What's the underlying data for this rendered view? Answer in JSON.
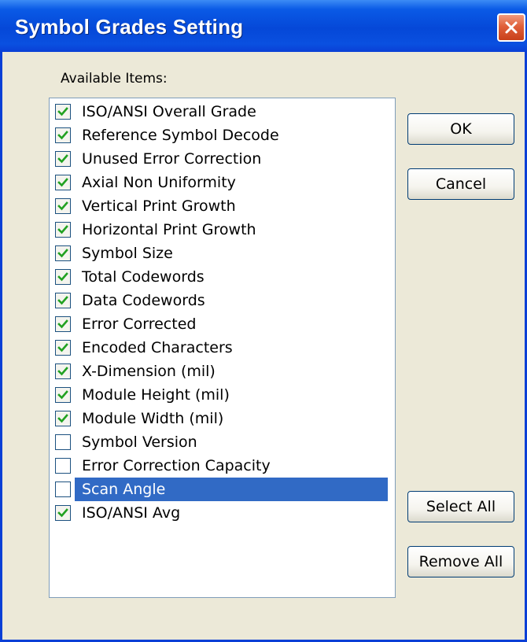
{
  "window": {
    "title": "Symbol Grades Setting"
  },
  "list": {
    "label": "Available Items:",
    "items": [
      {
        "label": "ISO/ANSI Overall Grade",
        "checked": true,
        "selected": false
      },
      {
        "label": "Reference Symbol Decode",
        "checked": true,
        "selected": false
      },
      {
        "label": "Unused Error Correction",
        "checked": true,
        "selected": false
      },
      {
        "label": "Axial Non Uniformity",
        "checked": true,
        "selected": false
      },
      {
        "label": "Vertical Print Growth",
        "checked": true,
        "selected": false
      },
      {
        "label": "Horizontal Print Growth",
        "checked": true,
        "selected": false
      },
      {
        "label": "Symbol Size",
        "checked": true,
        "selected": false
      },
      {
        "label": "Total Codewords",
        "checked": true,
        "selected": false
      },
      {
        "label": "Data Codewords",
        "checked": true,
        "selected": false
      },
      {
        "label": "Error Corrected",
        "checked": true,
        "selected": false
      },
      {
        "label": "Encoded Characters",
        "checked": true,
        "selected": false
      },
      {
        "label": "X-Dimension (mil)",
        "checked": true,
        "selected": false
      },
      {
        "label": "Module Height (mil)",
        "checked": true,
        "selected": false
      },
      {
        "label": "Module Width (mil)",
        "checked": true,
        "selected": false
      },
      {
        "label": "Symbol Version",
        "checked": false,
        "selected": false
      },
      {
        "label": "Error Correction Capacity",
        "checked": false,
        "selected": false
      },
      {
        "label": "Scan Angle",
        "checked": false,
        "selected": true
      },
      {
        "label": "ISO/ANSI Avg",
        "checked": true,
        "selected": false
      }
    ]
  },
  "buttons": {
    "ok": "OK",
    "cancel": "Cancel",
    "select_all": "Select All",
    "remove_all": "Remove All"
  },
  "colors": {
    "titlebar": "#0a50e0",
    "selection": "#316ac5",
    "checkmark": "#21a121",
    "close": "#e0603a"
  },
  "icons": {
    "close": "close-icon",
    "check": "checkmark-icon"
  }
}
